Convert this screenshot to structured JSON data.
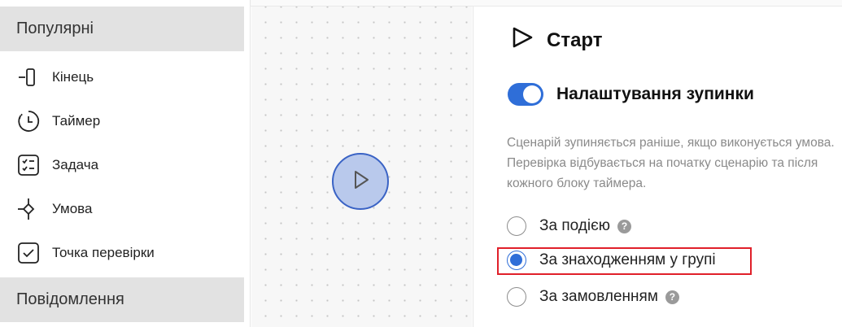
{
  "palette": {
    "sections": {
      "popular": "Популярні",
      "messages": "Повідомлення"
    },
    "items": [
      {
        "label": "Кінець",
        "icon": "end-icon"
      },
      {
        "label": "Таймер",
        "icon": "timer-icon"
      },
      {
        "label": "Задача",
        "icon": "task-icon"
      },
      {
        "label": "Умова",
        "icon": "condition-icon"
      },
      {
        "label": "Точка перевірки",
        "icon": "checkpoint-icon"
      }
    ]
  },
  "canvas": {
    "start_node_icon": "play-icon",
    "accent": "#3a63c5"
  },
  "panel": {
    "title": "Старт",
    "title_icon": "play-outline-icon",
    "stop_settings": {
      "label": "Налаштування зупинки",
      "enabled": true
    },
    "description": "Сценарій зупиняється раніше, якщо виконується умова. Перевірка відбувається на початку сценарію та після кожного блоку таймера.",
    "options": [
      {
        "label": "За подією",
        "checked": false,
        "help": true
      },
      {
        "label": "За знаходженням у групі",
        "checked": true,
        "help": false
      },
      {
        "label": "За замовленням",
        "checked": false,
        "help": true
      }
    ],
    "help_glyph": "?"
  },
  "colors": {
    "accent": "#2f6ed8",
    "highlight": "#e0202a",
    "section_bg": "#e2e2e2"
  }
}
